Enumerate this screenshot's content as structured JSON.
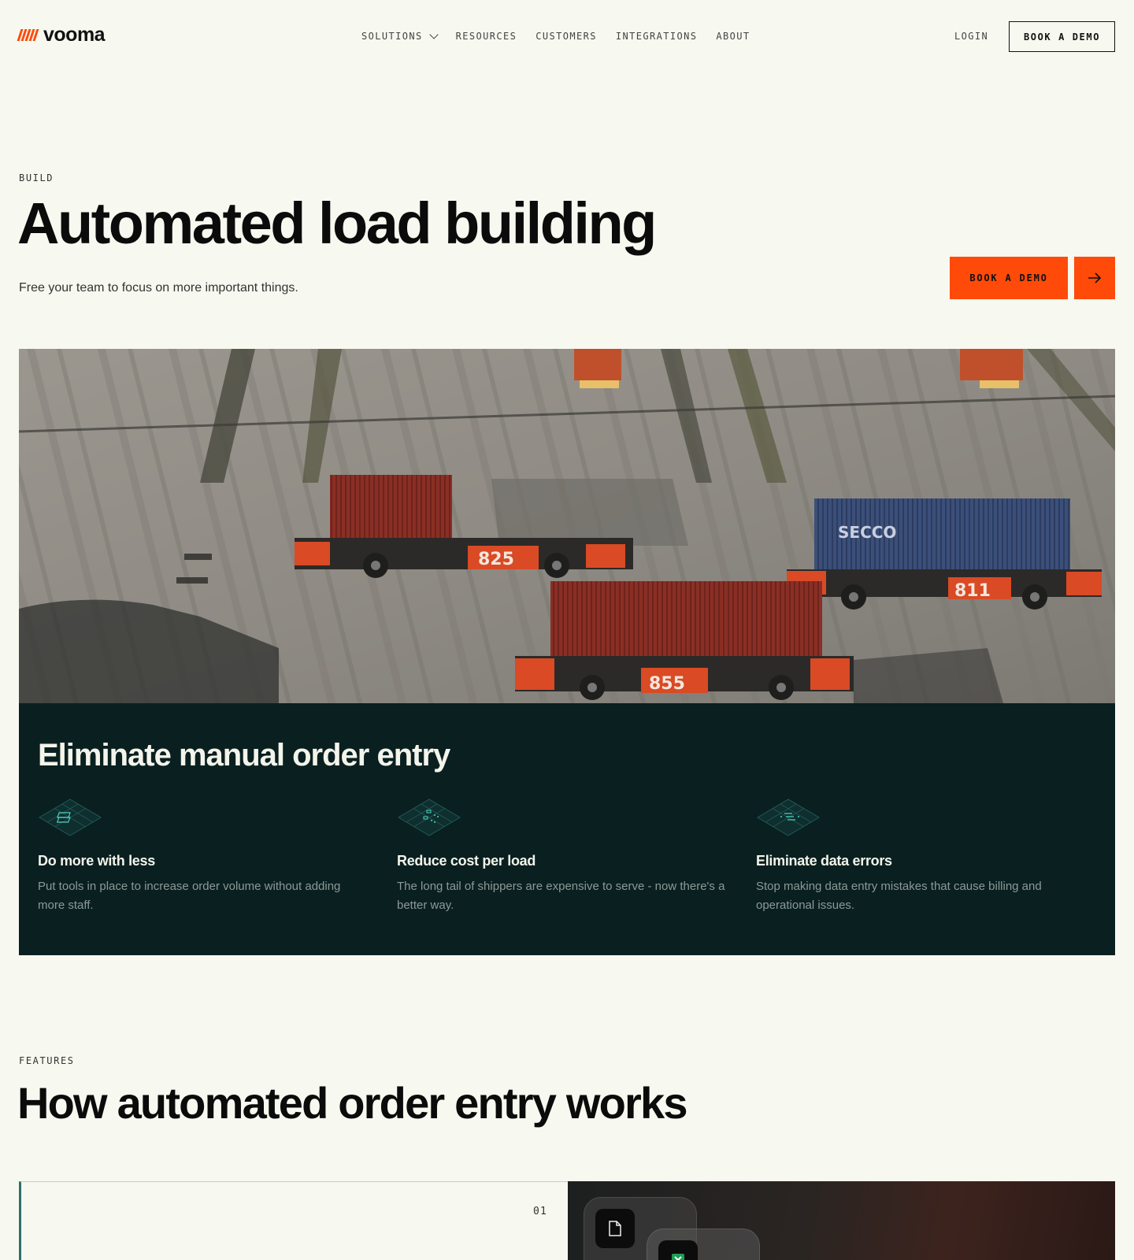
{
  "nav": {
    "logo_text": "vooma",
    "links": [
      {
        "label": "SOLUTIONS"
      },
      {
        "label": "RESOURCES"
      },
      {
        "label": "CUSTOMERS"
      },
      {
        "label": "INTEGRATIONS"
      },
      {
        "label": "ABOUT"
      }
    ],
    "login": "LOGIN",
    "demo": "BOOK A DEMO"
  },
  "hero": {
    "eyebrow": "BUILD",
    "title": "Automated load building",
    "subtitle": "Free your team to focus on more important things.",
    "cta": "BOOK A DEMO",
    "truck_numbers": [
      "825",
      "811",
      "855"
    ],
    "container_brand": "SECCO"
  },
  "benefits": {
    "title": "Eliminate manual order entry",
    "items": [
      {
        "title": "Do more with less",
        "desc": "Put tools in place to increase order volume without adding more staff."
      },
      {
        "title": "Reduce cost per load",
        "desc": "The long tail of shippers are expensive to serve - now there's a better way."
      },
      {
        "title": "Eliminate data errors",
        "desc": "Stop making data entry mistakes that cause billing and operational issues."
      }
    ]
  },
  "features": {
    "eyebrow": "FEATURES",
    "title": "How automated order entry works",
    "steps": [
      {
        "number": "01"
      }
    ]
  },
  "colors": {
    "accent": "#ff4a0a",
    "background": "#f7f8ef",
    "panel": "#0a1f20",
    "teal": "#2f6f6c"
  }
}
